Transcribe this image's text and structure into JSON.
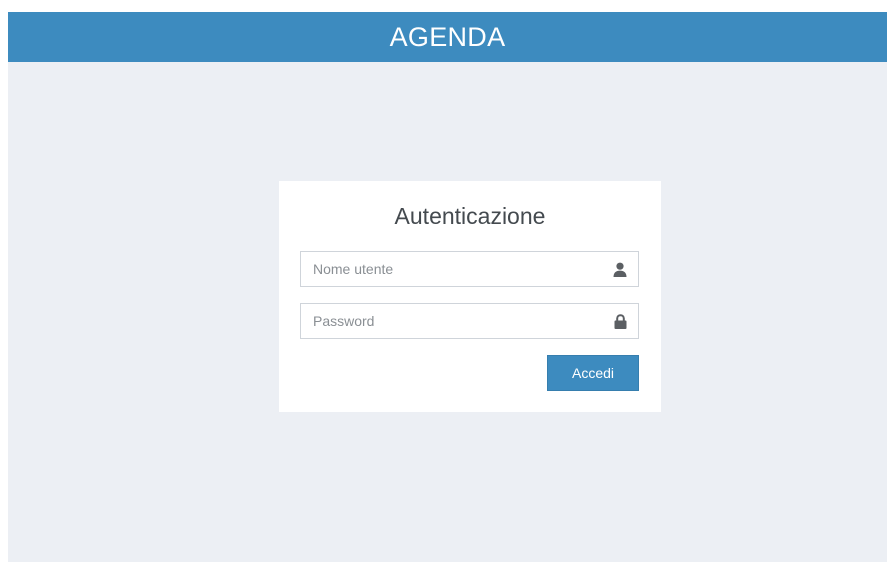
{
  "header": {
    "title": "AGENDA"
  },
  "login": {
    "title": "Autenticazione",
    "username": {
      "placeholder": "Nome utente",
      "value": "",
      "icon": "user-icon"
    },
    "password": {
      "placeholder": "Password",
      "value": "",
      "icon": "lock-icon"
    },
    "submit_label": "Accedi"
  },
  "colors": {
    "accent": "#3d8bbf",
    "background": "#eceff4",
    "panel": "#ffffff",
    "icon": "#5b5f63"
  }
}
